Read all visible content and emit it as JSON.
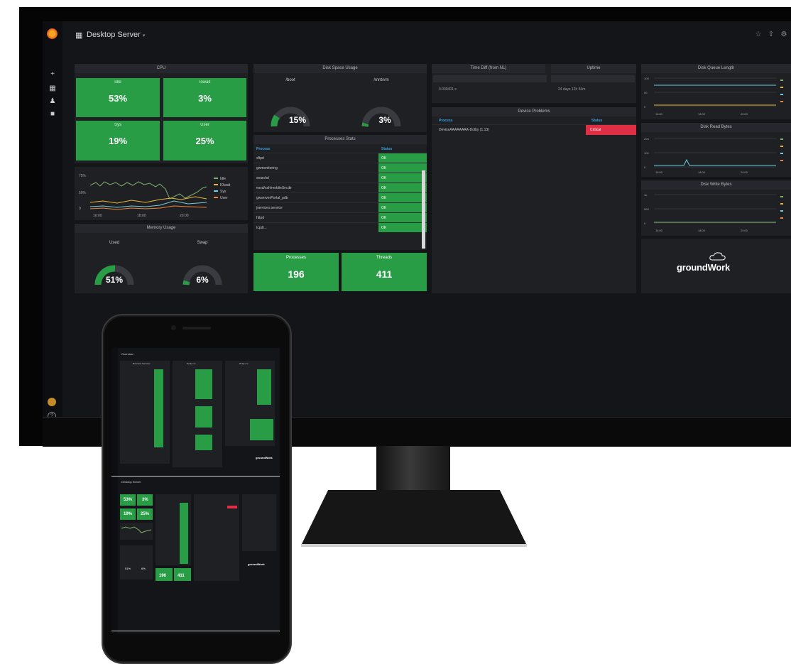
{
  "dashboard": {
    "title": "Desktop Server",
    "dropdown": "▾"
  },
  "toolbar": {
    "star": "☆",
    "share": "⇪",
    "settings": "⚙"
  },
  "sidebar": {
    "icons": [
      "plus-icon",
      "dashboards-icon",
      "alerts-icon",
      "config-icon"
    ]
  },
  "cpu": {
    "title": "CPU",
    "stats": [
      {
        "label": "Idle",
        "value": "53%"
      },
      {
        "label": "Iowait",
        "value": "3%"
      },
      {
        "label": "Sys",
        "value": "19%"
      },
      {
        "label": "User",
        "value": "25%"
      }
    ],
    "legend": [
      "Idle",
      "IOwait",
      "Sys",
      "User"
    ],
    "legend_colors": [
      "#7eb26d",
      "#eab839",
      "#6ed0e0",
      "#ef843c"
    ],
    "xticks": [
      "16:00",
      "18:00",
      "20:00"
    ],
    "yticks": [
      "75%",
      "50%",
      "0"
    ]
  },
  "memory": {
    "title": "Memory Usage",
    "gauges": [
      {
        "label": "Used",
        "value": "51%",
        "pct": 51
      },
      {
        "label": "Swap",
        "value": "6%",
        "pct": 6
      }
    ]
  },
  "disk": {
    "title": "Disk Space Usage",
    "gauges": [
      {
        "label": "/boot",
        "value": "15%",
        "pct": 15
      },
      {
        "label": "/mnt/vm",
        "value": "3%",
        "pct": 3
      }
    ]
  },
  "processes": {
    "title": "Processes Stats",
    "header": [
      "Process",
      "Status"
    ],
    "rows": [
      {
        "name": "sftpd",
        "status": "OK"
      },
      {
        "name": "gwmonitoring",
        "status": "OK"
      },
      {
        "name": "searchd",
        "status": "OK"
      },
      {
        "name": "essd/ssh/mobileSrv.dir",
        "status": "OK"
      },
      {
        "name": "gwserverPortal_pdb",
        "status": "OK"
      },
      {
        "name": "jservices.service",
        "status": "OK"
      },
      {
        "name": "httpd",
        "status": "OK"
      },
      {
        "name": "tcpdi...",
        "status": "OK"
      }
    ],
    "totals": [
      {
        "label": "Processes",
        "value": "196"
      },
      {
        "label": "Threads",
        "value": "411"
      }
    ]
  },
  "time_drift": {
    "title": "Time Diff (from NL)",
    "value": "0.000401 s"
  },
  "uptime": {
    "title": "Uptime",
    "value": "24 days 12h 34m"
  },
  "device_problems": {
    "title": "Device Problems",
    "header": [
      "Process",
      "Status"
    ],
    "rows": [
      {
        "name": "DeviceAAAAAAAA-Dolby (1.13)",
        "status": "Critical"
      }
    ]
  },
  "disk_queue": {
    "title": "Disk Queue Length",
    "yticks": [
      "100",
      "50",
      "0"
    ],
    "xticks": [
      "16:00",
      "18:00",
      "20:00"
    ]
  },
  "disk_read": {
    "title": "Disk Read Bytes",
    "yticks": [
      "200",
      "100",
      "0"
    ],
    "xticks": [
      "16:00",
      "18:00",
      "20:00"
    ]
  },
  "disk_write": {
    "title": "Disk Write Bytes",
    "yticks": [
      "1k",
      "500",
      "0"
    ],
    "xticks": [
      "16:00",
      "18:00",
      "20:00"
    ]
  },
  "brand": {
    "name": "groundWork"
  },
  "phone_top": {
    "title": "Overview",
    "panels": [
      "Business Services",
      "Delay ms",
      "Delay ms"
    ],
    "brand": "groundWork"
  },
  "phone_bottom": {
    "title": "Desktop Server",
    "stats": [
      "53%",
      "3%",
      "19%",
      "25%"
    ],
    "gauges": [
      "51%",
      "6%"
    ],
    "totals": [
      "196",
      "411"
    ],
    "brand": "groundWork"
  }
}
